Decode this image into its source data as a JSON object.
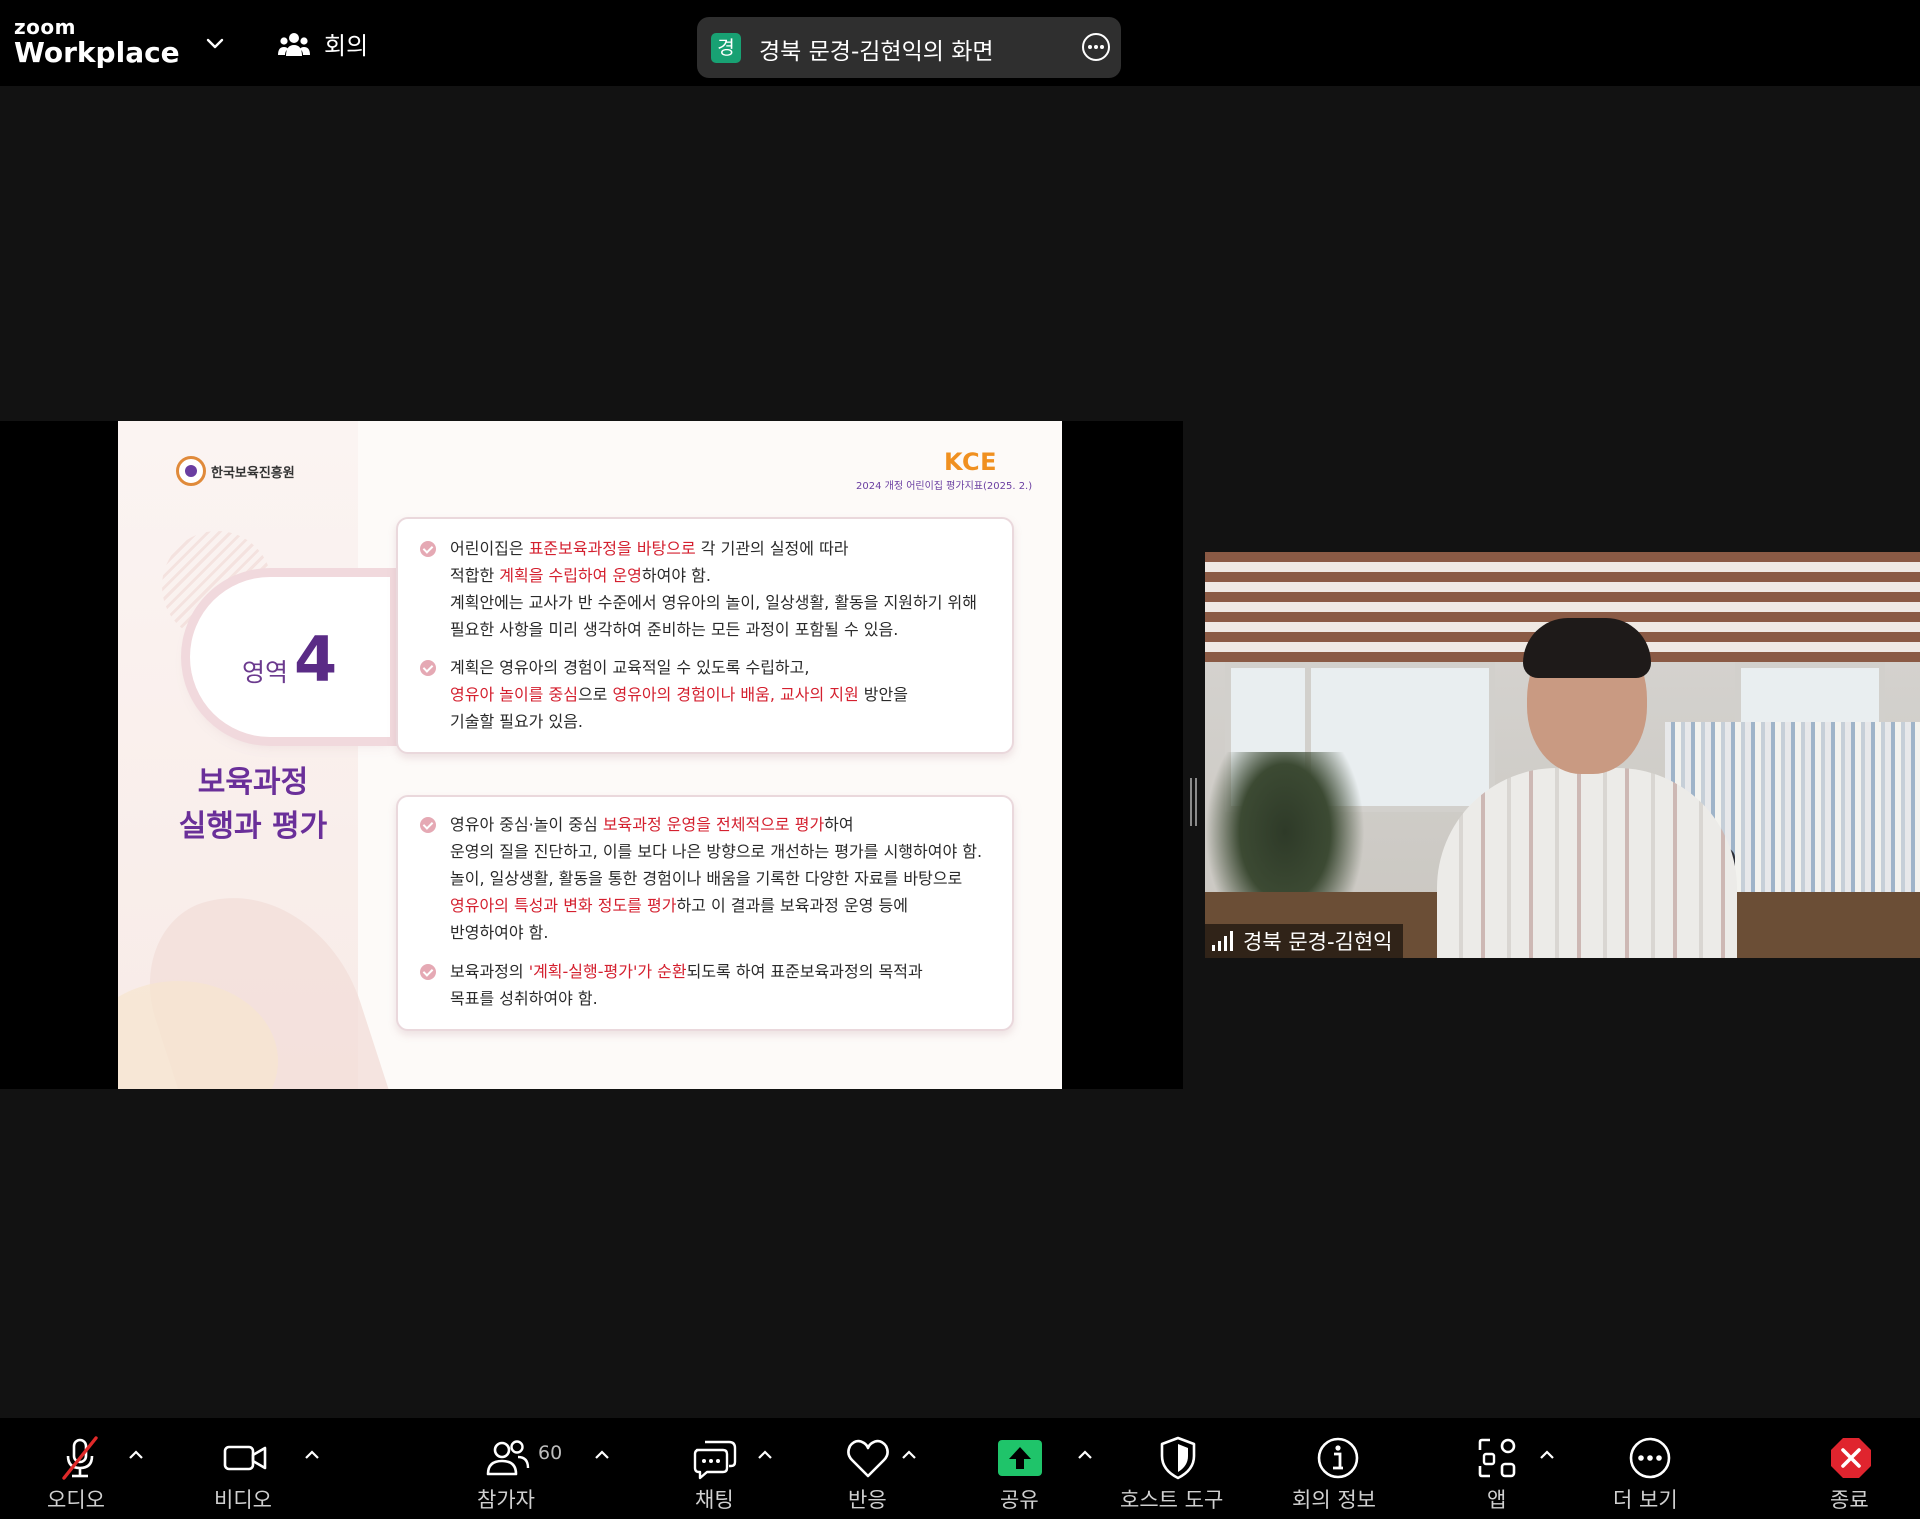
{
  "topbar": {
    "brand_line1": "zoom",
    "brand_line2": "Workplace",
    "brand_dropdown_icon": "chevron-down-icon",
    "meeting_icon": "people-icon",
    "meeting_label": "회의",
    "share_badge": "경",
    "share_title": "경북 문경-김현익의 화면",
    "share_more_icon": "ellipsis-circle-icon",
    "share_badge_color": "#18a173"
  },
  "slide": {
    "org_name": "한국보육진흥원",
    "org_mark": "KCPI",
    "kce_logo": "KCE",
    "kce_subtitle": "2024 개정 어린이집 평가지표(2025. 2.)",
    "area_label": "영역",
    "area_number": "4",
    "title_line1": "보육과정",
    "title_line2": "실행과 평가",
    "accent_color": "#d4202f",
    "box1": {
      "b1": {
        "l1": {
          "t1": "어린이집은 ",
          "r1": "표준보육과정을 바탕으로",
          "t2": " 각 기관의 실정에 따라"
        },
        "l2": {
          "t1": "적합한 ",
          "r1": "계획을 수립하여 운영",
          "t2": "하여야 함."
        },
        "l3": "계획안에는 교사가 반 수준에서 영유아의 놀이, 일상생활, 활동을 지원하기 위해",
        "l4": "필요한 사항을 미리 생각하여 준비하는 모든 과정이 포함될 수 있음."
      },
      "b2": {
        "l1": "계획은 영유아의 경험이 교육적일 수 있도록 수립하고,",
        "l2": {
          "r1": "영유아 놀이를 중심",
          "t1": "으로 ",
          "r2": "영유아의 경험이나 배움, 교사의 지원",
          "t2": " 방안을"
        },
        "l3": "기술할 필요가 있음."
      }
    },
    "box2": {
      "b1": {
        "l1": {
          "t1": "영유아 중심·놀이 중심 ",
          "r1": "보육과정 운영을 전체적으로 평가",
          "t2": "하여"
        },
        "l2": "운영의 질을 진단하고, 이를 보다 나은 방향으로 개선하는 평가를 시행하여야 함.",
        "l3": "놀이, 일상생활, 활동을 통한 경험이나 배움을 기록한 다양한 자료를 바탕으로",
        "l4": {
          "r1": "영유아의 특성과 변화 정도를 평가",
          "t1": "하고 이 결과를 보육과정 운영 등에"
        },
        "l5": "반영하여야 함."
      },
      "b2": {
        "l1": {
          "t1": "보육과정의 ",
          "r1": "'계획-실행-평가'가 순환",
          "t2": "되도록 하여 표준보육과정의 목적과"
        },
        "l2": "목표를 성취하여야 함."
      }
    }
  },
  "video": {
    "participant_name": "경북 문경-김현익",
    "signal_icon": "signal-bars-icon"
  },
  "toolbar": {
    "audio": {
      "label": "오디오",
      "icon": "microphone-muted-icon",
      "mute_color": "#e02a2a"
    },
    "video": {
      "label": "비디오",
      "icon": "video-camera-icon"
    },
    "participants": {
      "label": "참가자",
      "icon": "participants-icon",
      "count": "60"
    },
    "chat": {
      "label": "채팅",
      "icon": "chat-bubble-icon"
    },
    "reactions": {
      "label": "반응",
      "icon": "heart-icon"
    },
    "share": {
      "label": "공유",
      "icon": "share-arrow-icon",
      "color": "#1fc46a"
    },
    "host_tools": {
      "label": "호스트 도구",
      "icon": "shield-icon"
    },
    "meeting_info": {
      "label": "회의 정보",
      "icon": "info-icon"
    },
    "apps": {
      "label": "앱",
      "icon": "apps-icon"
    },
    "more": {
      "label": "더 보기",
      "icon": "more-dots-icon"
    },
    "end": {
      "label": "종료",
      "icon": "end-octagon-icon",
      "color": "#e0242e"
    },
    "caret_icon": "caret-up-icon"
  }
}
